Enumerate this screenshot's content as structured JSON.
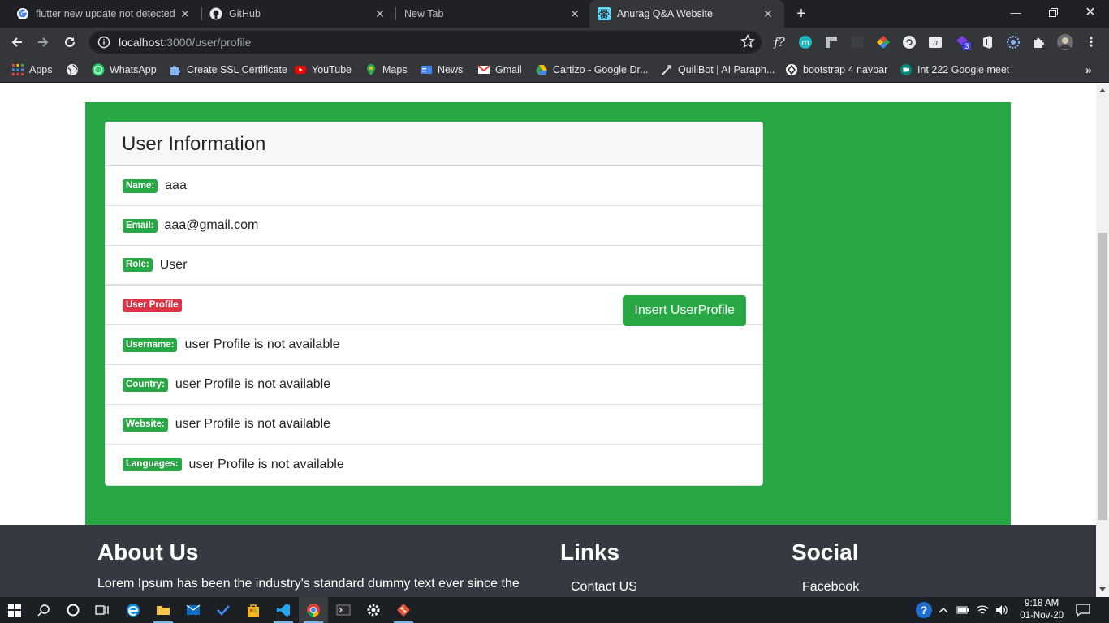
{
  "browser": {
    "tabs": [
      {
        "title": "flutter new update not detected",
        "icon": "google-icon",
        "active": false
      },
      {
        "title": "GitHub",
        "icon": "github-icon",
        "active": false
      },
      {
        "title": "New Tab",
        "icon": "",
        "active": false
      },
      {
        "title": "Anurag Q&A Website",
        "icon": "react-icon",
        "active": true
      }
    ],
    "url_host": "localhost",
    "url_path": ":3000/user/profile",
    "bookmarks": [
      {
        "label": "Apps",
        "icon": "apps-grid-icon"
      },
      {
        "label": "",
        "icon": "globe-icon"
      },
      {
        "label": "WhatsApp",
        "icon": "whatsapp-icon"
      },
      {
        "label": "Create SSL Certificate",
        "icon": "puzzle-icon"
      },
      {
        "label": "YouTube",
        "icon": "youtube-icon"
      },
      {
        "label": "Maps",
        "icon": "maps-pin-icon"
      },
      {
        "label": "News",
        "icon": "news-icon"
      },
      {
        "label": "Gmail",
        "icon": "gmail-icon"
      },
      {
        "label": "Cartizo - Google Dr...",
        "icon": "drive-icon"
      },
      {
        "label": "QuillBot | AI Paraph...",
        "icon": "quill-icon"
      },
      {
        "label": "bootstrap 4 navbar",
        "icon": "bootstrap-icon"
      },
      {
        "label": "Int 222 Google meet",
        "icon": "meet-icon"
      }
    ],
    "extension_badge": "3"
  },
  "page": {
    "card_title": "User Information",
    "name_label": "Name:",
    "name_value": "aaa",
    "email_label": "Email:",
    "email_value": "aaa@gmail.com",
    "role_label": "Role:",
    "role_value": "User",
    "profile_label": "User Profile",
    "insert_button": "Insert UserProfile",
    "username_label": "Username:",
    "country_label": "Country:",
    "website_label": "Website:",
    "languages_label": "Languages:",
    "not_available": "user Profile is not available"
  },
  "footer": {
    "about_title": "About Us",
    "about_text": "Lorem Ipsum has been the industry's standard dummy text ever since the",
    "links_title": "Links",
    "links_first": "Contact US",
    "social_title": "Social",
    "social_first": "Facebook"
  },
  "taskbar": {
    "time": "9:18 AM",
    "date": "01-Nov-20"
  },
  "colors": {
    "success": "#28a745",
    "danger": "#dc3545",
    "footer_bg": "#343a40"
  }
}
